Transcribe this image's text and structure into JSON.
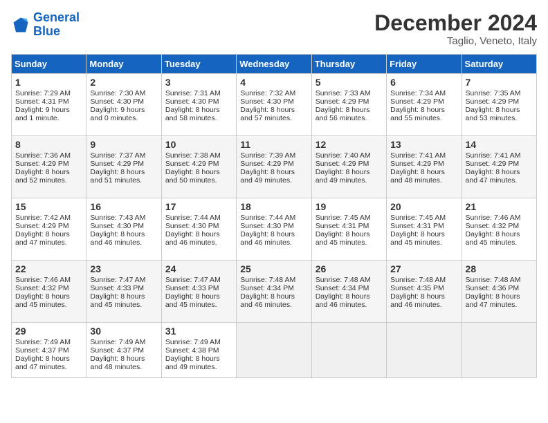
{
  "header": {
    "logo_line1": "General",
    "logo_line2": "Blue",
    "month": "December 2024",
    "location": "Taglio, Veneto, Italy"
  },
  "weekdays": [
    "Sunday",
    "Monday",
    "Tuesday",
    "Wednesday",
    "Thursday",
    "Friday",
    "Saturday"
  ],
  "weeks": [
    [
      {
        "day": "1",
        "lines": [
          "Sunrise: 7:29 AM",
          "Sunset: 4:31 PM",
          "Daylight: 9 hours",
          "and 1 minute."
        ]
      },
      {
        "day": "2",
        "lines": [
          "Sunrise: 7:30 AM",
          "Sunset: 4:30 PM",
          "Daylight: 9 hours",
          "and 0 minutes."
        ]
      },
      {
        "day": "3",
        "lines": [
          "Sunrise: 7:31 AM",
          "Sunset: 4:30 PM",
          "Daylight: 8 hours",
          "and 58 minutes."
        ]
      },
      {
        "day": "4",
        "lines": [
          "Sunrise: 7:32 AM",
          "Sunset: 4:30 PM",
          "Daylight: 8 hours",
          "and 57 minutes."
        ]
      },
      {
        "day": "5",
        "lines": [
          "Sunrise: 7:33 AM",
          "Sunset: 4:29 PM",
          "Daylight: 8 hours",
          "and 56 minutes."
        ]
      },
      {
        "day": "6",
        "lines": [
          "Sunrise: 7:34 AM",
          "Sunset: 4:29 PM",
          "Daylight: 8 hours",
          "and 55 minutes."
        ]
      },
      {
        "day": "7",
        "lines": [
          "Sunrise: 7:35 AM",
          "Sunset: 4:29 PM",
          "Daylight: 8 hours",
          "and 53 minutes."
        ]
      }
    ],
    [
      {
        "day": "8",
        "lines": [
          "Sunrise: 7:36 AM",
          "Sunset: 4:29 PM",
          "Daylight: 8 hours",
          "and 52 minutes."
        ]
      },
      {
        "day": "9",
        "lines": [
          "Sunrise: 7:37 AM",
          "Sunset: 4:29 PM",
          "Daylight: 8 hours",
          "and 51 minutes."
        ]
      },
      {
        "day": "10",
        "lines": [
          "Sunrise: 7:38 AM",
          "Sunset: 4:29 PM",
          "Daylight: 8 hours",
          "and 50 minutes."
        ]
      },
      {
        "day": "11",
        "lines": [
          "Sunrise: 7:39 AM",
          "Sunset: 4:29 PM",
          "Daylight: 8 hours",
          "and 49 minutes."
        ]
      },
      {
        "day": "12",
        "lines": [
          "Sunrise: 7:40 AM",
          "Sunset: 4:29 PM",
          "Daylight: 8 hours",
          "and 49 minutes."
        ]
      },
      {
        "day": "13",
        "lines": [
          "Sunrise: 7:41 AM",
          "Sunset: 4:29 PM",
          "Daylight: 8 hours",
          "and 48 minutes."
        ]
      },
      {
        "day": "14",
        "lines": [
          "Sunrise: 7:41 AM",
          "Sunset: 4:29 PM",
          "Daylight: 8 hours",
          "and 47 minutes."
        ]
      }
    ],
    [
      {
        "day": "15",
        "lines": [
          "Sunrise: 7:42 AM",
          "Sunset: 4:29 PM",
          "Daylight: 8 hours",
          "and 47 minutes."
        ]
      },
      {
        "day": "16",
        "lines": [
          "Sunrise: 7:43 AM",
          "Sunset: 4:30 PM",
          "Daylight: 8 hours",
          "and 46 minutes."
        ]
      },
      {
        "day": "17",
        "lines": [
          "Sunrise: 7:44 AM",
          "Sunset: 4:30 PM",
          "Daylight: 8 hours",
          "and 46 minutes."
        ]
      },
      {
        "day": "18",
        "lines": [
          "Sunrise: 7:44 AM",
          "Sunset: 4:30 PM",
          "Daylight: 8 hours",
          "and 46 minutes."
        ]
      },
      {
        "day": "19",
        "lines": [
          "Sunrise: 7:45 AM",
          "Sunset: 4:31 PM",
          "Daylight: 8 hours",
          "and 45 minutes."
        ]
      },
      {
        "day": "20",
        "lines": [
          "Sunrise: 7:45 AM",
          "Sunset: 4:31 PM",
          "Daylight: 8 hours",
          "and 45 minutes."
        ]
      },
      {
        "day": "21",
        "lines": [
          "Sunrise: 7:46 AM",
          "Sunset: 4:32 PM",
          "Daylight: 8 hours",
          "and 45 minutes."
        ]
      }
    ],
    [
      {
        "day": "22",
        "lines": [
          "Sunrise: 7:46 AM",
          "Sunset: 4:32 PM",
          "Daylight: 8 hours",
          "and 45 minutes."
        ]
      },
      {
        "day": "23",
        "lines": [
          "Sunrise: 7:47 AM",
          "Sunset: 4:33 PM",
          "Daylight: 8 hours",
          "and 45 minutes."
        ]
      },
      {
        "day": "24",
        "lines": [
          "Sunrise: 7:47 AM",
          "Sunset: 4:33 PM",
          "Daylight: 8 hours",
          "and 45 minutes."
        ]
      },
      {
        "day": "25",
        "lines": [
          "Sunrise: 7:48 AM",
          "Sunset: 4:34 PM",
          "Daylight: 8 hours",
          "and 46 minutes."
        ]
      },
      {
        "day": "26",
        "lines": [
          "Sunrise: 7:48 AM",
          "Sunset: 4:34 PM",
          "Daylight: 8 hours",
          "and 46 minutes."
        ]
      },
      {
        "day": "27",
        "lines": [
          "Sunrise: 7:48 AM",
          "Sunset: 4:35 PM",
          "Daylight: 8 hours",
          "and 46 minutes."
        ]
      },
      {
        "day": "28",
        "lines": [
          "Sunrise: 7:48 AM",
          "Sunset: 4:36 PM",
          "Daylight: 8 hours",
          "and 47 minutes."
        ]
      }
    ],
    [
      {
        "day": "29",
        "lines": [
          "Sunrise: 7:49 AM",
          "Sunset: 4:37 PM",
          "Daylight: 8 hours",
          "and 47 minutes."
        ]
      },
      {
        "day": "30",
        "lines": [
          "Sunrise: 7:49 AM",
          "Sunset: 4:37 PM",
          "Daylight: 8 hours",
          "and 48 minutes."
        ]
      },
      {
        "day": "31",
        "lines": [
          "Sunrise: 7:49 AM",
          "Sunset: 4:38 PM",
          "Daylight: 8 hours",
          "and 49 minutes."
        ]
      },
      null,
      null,
      null,
      null
    ]
  ]
}
